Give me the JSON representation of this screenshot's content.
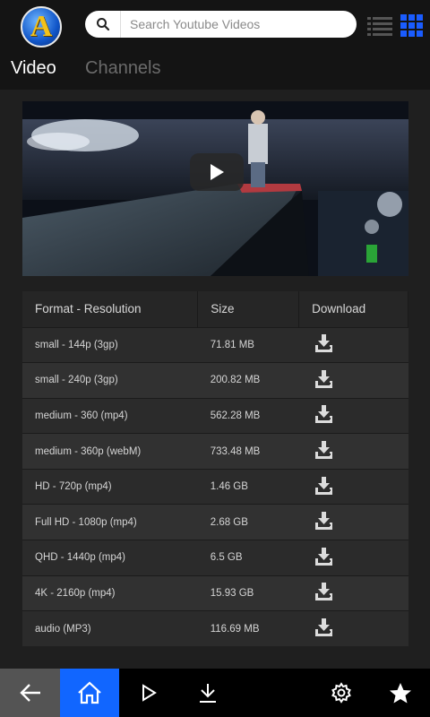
{
  "header": {
    "logo_letter": "A",
    "search_placeholder": "Search Youtube Videos"
  },
  "tabs": [
    {
      "label": "Video",
      "active": true
    },
    {
      "label": "Channels",
      "active": false
    }
  ],
  "table": {
    "headers": [
      "Format - Resolution",
      "Size",
      "Download"
    ],
    "rows": [
      {
        "format": "small - 144p (3gp)",
        "size": "71.81 MB"
      },
      {
        "format": "small - 240p (3gp)",
        "size": "200.82 MB"
      },
      {
        "format": "medium - 360 (mp4)",
        "size": "562.28 MB"
      },
      {
        "format": "medium - 360p (webM)",
        "size": "733.48 MB"
      },
      {
        "format": "HD - 720p (mp4)",
        "size": "1.46 GB"
      },
      {
        "format": "Full HD - 1080p (mp4)",
        "size": "2.68 GB"
      },
      {
        "format": "QHD - 1440p (mp4)",
        "size": "6.5 GB"
      },
      {
        "format": "4K - 2160p (mp4)",
        "size": "15.93 GB"
      },
      {
        "format": "audio (MP3)",
        "size": "116.69 MB"
      }
    ]
  },
  "bottom_nav": [
    "back-arrow-icon",
    "home-icon",
    "play-icon",
    "download-icon",
    "settings-icon",
    "star-icon"
  ],
  "colors": {
    "accent": "#1166ff",
    "grid_view_icon": "#1a5cff"
  }
}
